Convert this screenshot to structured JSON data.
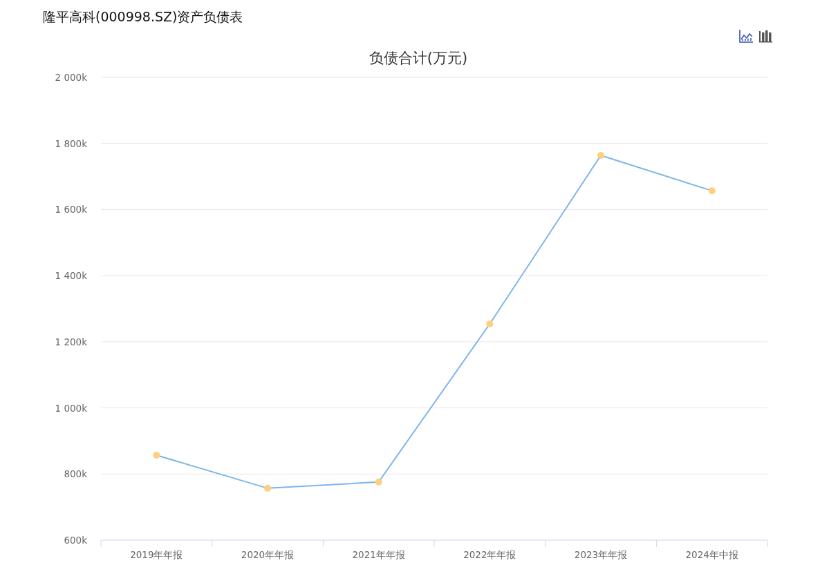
{
  "page_title": "隆平高科(000998.SZ)资产负债表",
  "toolbar": {
    "buttons": [
      {
        "kind": "line",
        "selected": true
      },
      {
        "kind": "bar",
        "selected": false
      }
    ]
  },
  "chart_data": {
    "type": "line",
    "title": "负债合计(万元)",
    "categories": [
      "2019年年报",
      "2020年年报",
      "2021年年报",
      "2022年年报",
      "2023年年报",
      "2024年中报"
    ],
    "grid": true,
    "series": [
      {
        "color": "#7cb5ec",
        "marker": true,
        "values": [
          857,
          757,
          776,
          1254,
          1764,
          1657
        ]
      }
    ],
    "ylim": [
      600,
      2000
    ],
    "yticks": [
      {
        "value": 600,
        "label": "600k"
      },
      {
        "value": 800,
        "label": "800k"
      },
      {
        "value": 1000,
        "label": "1 000k"
      },
      {
        "value": 1200,
        "label": "1 200k"
      },
      {
        "value": 1400,
        "label": "1 400k"
      },
      {
        "value": 1600,
        "label": "1 600k"
      },
      {
        "value": 1800,
        "label": "1 800k"
      },
      {
        "value": 2000,
        "label": "2 000k"
      }
    ]
  }
}
